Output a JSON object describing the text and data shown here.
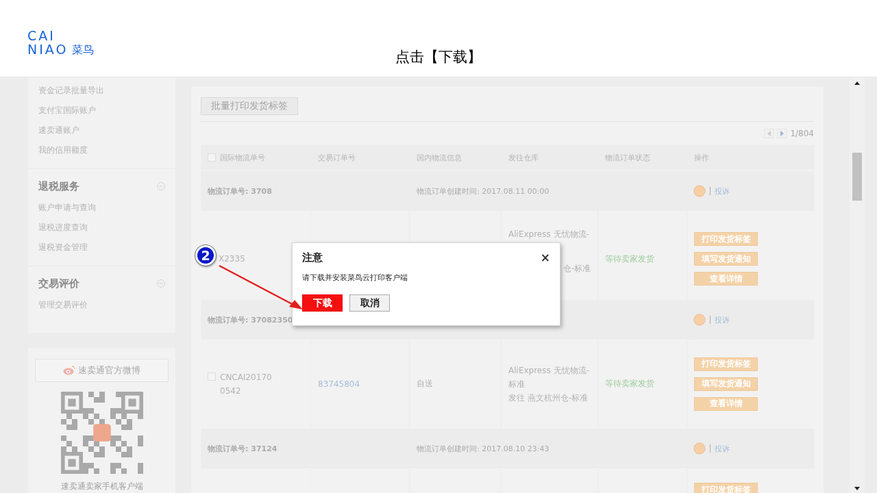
{
  "slide": {
    "logo": {
      "line_1": "CAI",
      "line_2": "NIAO",
      "chinese": "菜鸟"
    },
    "caption": "点击【下载】"
  },
  "sidebar": {
    "sections": [
      {
        "items": [
          "资金记录批量导出",
          "支付宝国际账户",
          "速卖通账户",
          "我的信用额度"
        ]
      },
      {
        "heading": "退税服务",
        "expanded": true,
        "items": [
          "账户申请与查询",
          "退税进度查询",
          "退税资金管理"
        ]
      },
      {
        "heading": "交易评价",
        "expanded": true,
        "items": [
          "管理交易评价"
        ]
      }
    ],
    "weibo_button": "速卖通官方微博",
    "qr_caption": "速卖通卖家手机客户端"
  },
  "toolbar": {
    "batch_button": "批量打印发货标签",
    "pager": "1/804"
  },
  "table": {
    "select_all": {
      "checked": false
    },
    "columns": [
      "国际物流单号",
      "交易订单号",
      "国内物流信息",
      "发往仓库",
      "物流订单状态",
      "操作"
    ],
    "orders": [
      {
        "order_no": "物流订单号: 3708",
        "created": "物流订单创建时间: 2017.08.11 00:00",
        "complaint": "投诉",
        "item": {
          "tracking_lines": [
            "X2335"
          ],
          "warehouse_lines": [
            "AliExpress 无忧物流-"
          ],
          "warehouse_tail": "仓-标准",
          "status": "等待卖家发货",
          "actions": [
            "打印发货标签",
            "填写发货通知",
            "查看详情"
          ]
        }
      },
      {
        "order_no": "物流订单号: 37082350",
        "complaint": "投诉",
        "item": {
          "checked": false,
          "tracking_lines": [
            "CNCAI20170",
            "0542"
          ],
          "trade_no": "83745804",
          "domestic": "自送",
          "warehouse_lines": [
            "AliExpress 无忧物流-",
            "标准",
            "发往 燕文杭州仓-标准"
          ],
          "status": "等待卖家发货",
          "actions": [
            "打印发货标签",
            "填写发货通知",
            "查看详情"
          ]
        }
      },
      {
        "order_no": "物流订单号: 37124",
        "created": "物流订单创建时间: 2017.08.10 23:43",
        "complaint": "投诉",
        "item": {
          "actions": [
            "打印发货标签"
          ]
        }
      }
    ]
  },
  "dialog": {
    "title": "注意",
    "close": "×",
    "message": "请下载并安装菜鸟云打印客户端",
    "buttons": [
      {
        "label": "下载",
        "kind": "primary"
      },
      {
        "label": "取消",
        "kind": "secondary"
      }
    ]
  },
  "step_marker": "2"
}
